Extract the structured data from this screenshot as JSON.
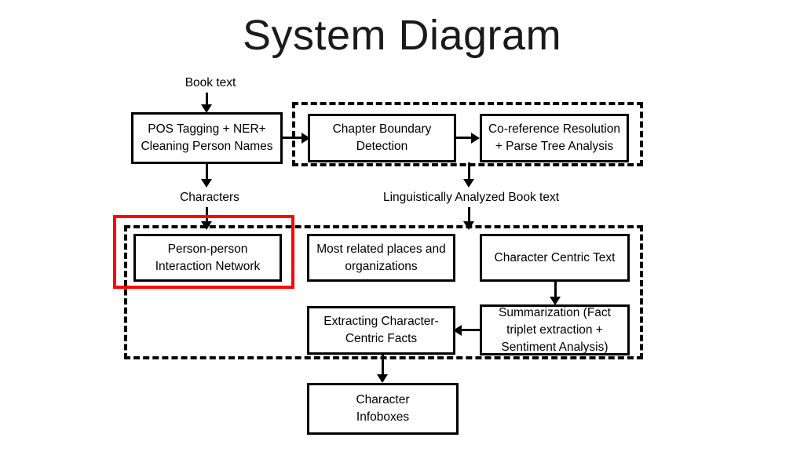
{
  "slide": {
    "title": "System Diagram",
    "background_color": "#FFFFFF",
    "line_color": "#000000",
    "highlight_color": "#FF0000"
  },
  "captions": {
    "book_text": "Book text",
    "characters": "Characters",
    "linguistic": "Linguistically Analyzed Book text"
  },
  "nodes": {
    "pos_tagging": "POS Tagging + NER+\nCleaning Person Names",
    "pos_tagging_line1": "POS Tagging + NER+",
    "pos_tagging_line2": "Cleaning Person Names",
    "chapter_boundary_line1": "Chapter Boundary",
    "chapter_boundary_line2": "Detection",
    "coreference_line1": "Co-reference Resolution",
    "coreference_line2": "+ Parse Tree Analysis",
    "person_person_line1": "Person-person",
    "person_person_line2": "Interaction Network",
    "most_related_line1": "Most related places and",
    "most_related_line2": "organizations",
    "character_centric_text": "Character Centric Text",
    "extracting_facts_line1": "Extracting Character-",
    "extracting_facts_line2": "Centric Facts",
    "summarization_line1": "Summarization (Fact",
    "summarization_line2": "triplet extraction +",
    "summarization_line3": "Sentiment Analysis)",
    "character_infoboxes_line1": "Character",
    "character_infoboxes_line2": "Infoboxes"
  },
  "groups": {
    "preprocessing_pipeline": "Linguistic analysis pipeline group",
    "analysis_outputs": "Character analysis outputs group"
  },
  "highlight": {
    "label": "Person-person Interaction Network highlight"
  }
}
